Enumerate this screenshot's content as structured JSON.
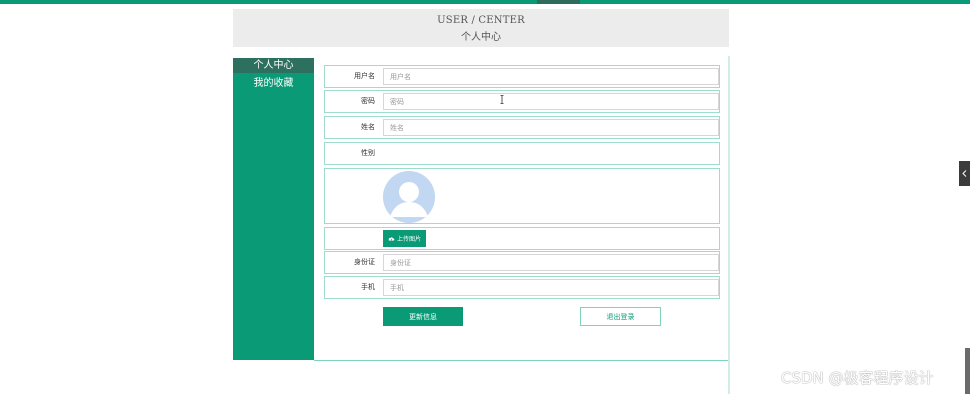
{
  "header": {
    "title": "USER / CENTER",
    "subtitle": "个人中心"
  },
  "sidebar": {
    "items": [
      {
        "label": "个人中心",
        "active": true
      },
      {
        "label": "我的收藏",
        "active": false
      }
    ]
  },
  "form": {
    "username": {
      "label": "用户名",
      "placeholder": "用户名",
      "value": ""
    },
    "password": {
      "label": "密码",
      "placeholder": "密码",
      "value": ""
    },
    "name": {
      "label": "姓名",
      "placeholder": "姓名",
      "value": ""
    },
    "gender": {
      "label": "性别"
    },
    "avatar": {
      "icon": "avatar-placeholder-icon"
    },
    "upload": {
      "label": "上传图片",
      "icon": "cloud-upload-icon"
    },
    "id_card": {
      "label": "身份证",
      "placeholder": "身份证",
      "value": ""
    },
    "phone": {
      "label": "手机",
      "placeholder": "手机",
      "value": ""
    }
  },
  "actions": {
    "update_label": "更新信息",
    "logout_label": "退出登录"
  },
  "watermark": "CSDN @极客程序设计",
  "colors": {
    "accent": "#0b9a76",
    "sidebar_active": "#2e7060",
    "border": "#9fdccc",
    "banner_bg": "#ececec"
  }
}
